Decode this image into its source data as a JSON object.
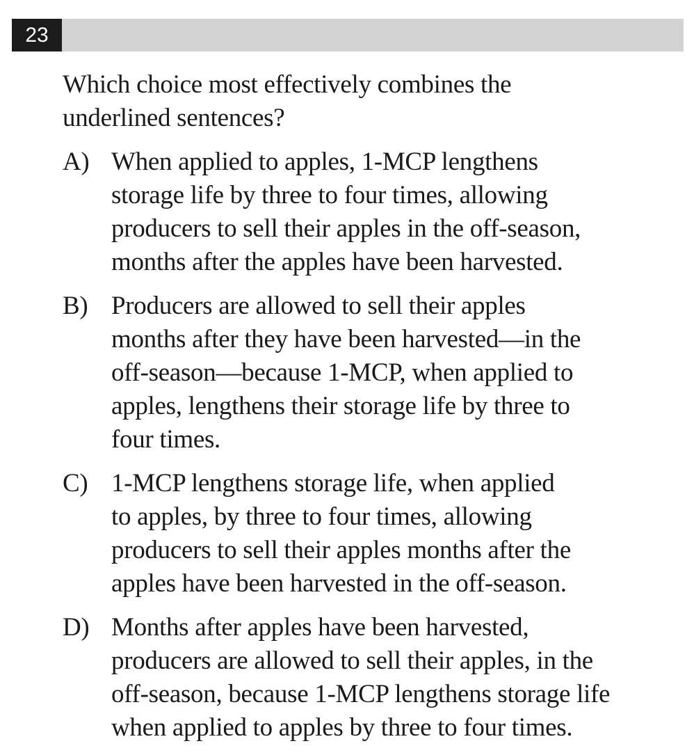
{
  "question": {
    "number": "23",
    "prompt": "Which choice most effectively combines the\nunderlined sentences?"
  },
  "choices": [
    {
      "letter": "A)",
      "text": "When applied to apples, 1-MCP lengthens\nstorage life by three to four times, allowing\nproducers to sell their apples in the off-season,\nmonths after the apples have been harvested."
    },
    {
      "letter": "B)",
      "text": "Producers are allowed to sell their apples\nmonths after they have been harvested—in the\noff-season—because 1-MCP, when applied to\napples, lengthens their storage life by three to\nfour times."
    },
    {
      "letter": "C)",
      "text": "1-MCP lengthens storage life, when applied\nto apples, by three to four times, allowing\nproducers to sell their apples months after the\napples have been harvested in the off-season."
    },
    {
      "letter": "D)",
      "text": "Months after apples have been harvested,\nproducers are allowed to sell their apples, in the\noff-season, because 1-MCP lengthens storage life\nwhen applied to apples by three to four times."
    }
  ]
}
